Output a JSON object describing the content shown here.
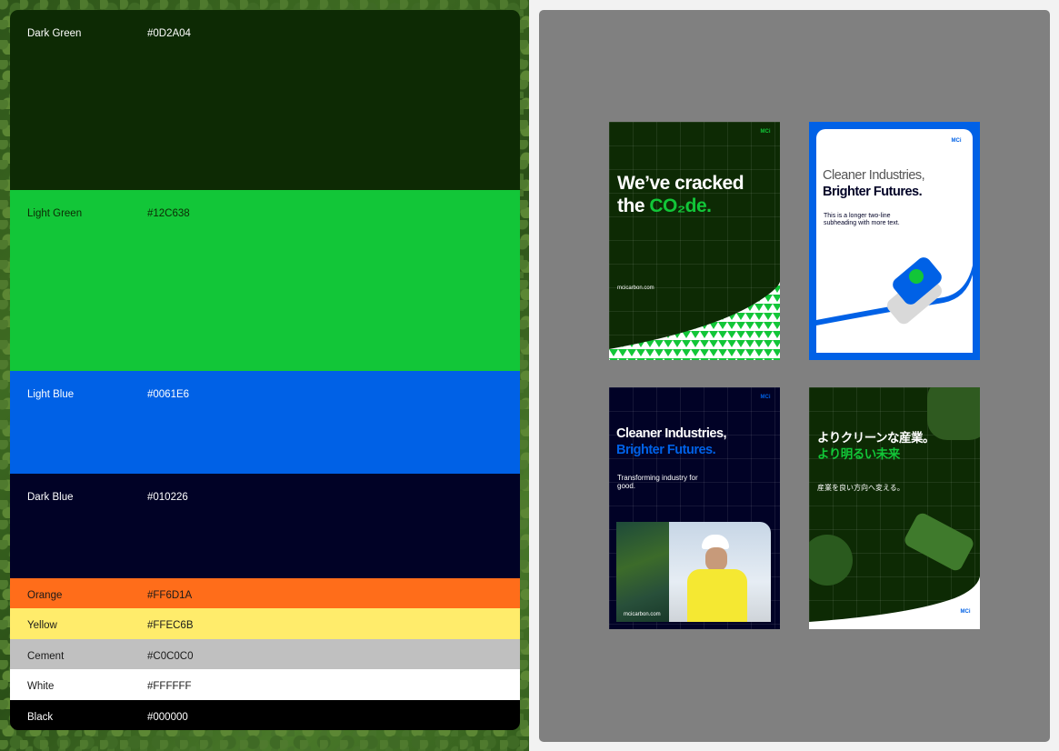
{
  "palette": [
    {
      "name": "Dark Green",
      "hex": "#0D2A04",
      "bg": "#0d2a04",
      "fg": "#ffffff"
    },
    {
      "name": "Light Green",
      "hex": "#12C638",
      "bg": "#12c638",
      "fg": "#0d2a04"
    },
    {
      "name": "Light Blue",
      "hex": "#0061E6",
      "bg": "#0061e6",
      "fg": "#ffffff"
    },
    {
      "name": "Dark Blue",
      "hex": "#010226",
      "bg": "#010226",
      "fg": "#ffffff"
    },
    {
      "name": "Orange",
      "hex": "#FF6D1A",
      "bg": "#ff6d1a",
      "fg": "#1a1a1a"
    },
    {
      "name": "Yellow",
      "hex": "#FFEC6B",
      "bg": "#ffec6b",
      "fg": "#1a1a1a"
    },
    {
      "name": "Cement",
      "hex": "#C0C0C0",
      "bg": "#c0c0c0",
      "fg": "#1a1a1a"
    },
    {
      "name": "White",
      "hex": "#FFFFFF",
      "bg": "#ffffff",
      "fg": "#1a1a1a"
    },
    {
      "name": "Black",
      "hex": "#000000",
      "bg": "#000000",
      "fg": "#ffffff"
    }
  ],
  "posters": {
    "p1": {
      "title_line1": "We’ve cracked",
      "title_line2_a": "the ",
      "title_line2_b": "CO₂de.",
      "url": "mcicarbon.com",
      "logo": "MCi CARBON"
    },
    "p2": {
      "title_line1": "Cleaner Industries,",
      "title_line2": "Brighter Futures.",
      "sub": "This is a longer two-line subheading with more text.",
      "logo": "MCi CARBON"
    },
    "p3": {
      "title_line1": "Cleaner Industries,",
      "title_line2": "Brighter Futures.",
      "sub": "Transforming industry for good.",
      "url": "mcicarbon.com",
      "logo": "MCi CARBON"
    },
    "p4": {
      "title_line1": "よりクリーンな産業。",
      "title_line2": "より明るい未来",
      "sub": "産業を良い方向へ変える。",
      "logo": "MCi CARBON"
    }
  }
}
